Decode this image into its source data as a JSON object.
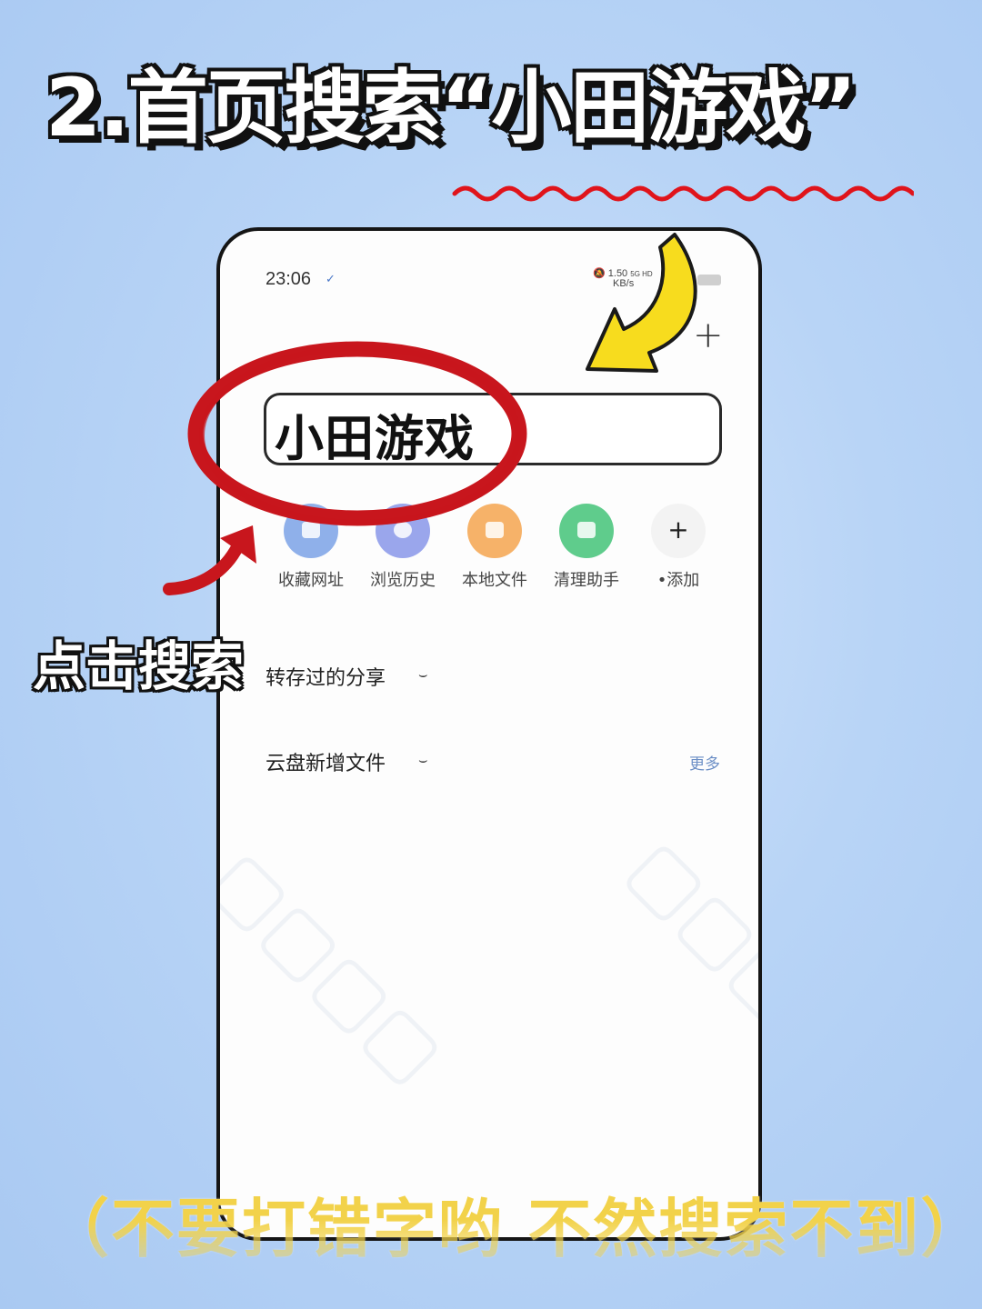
{
  "headline": "2.首页搜索“小田游戏”",
  "status_bar": {
    "time": "23:06",
    "net_speed": "1.50",
    "net_unit": "KB/s",
    "net_type": "5G HD"
  },
  "search": {
    "query": "小田游戏"
  },
  "quick_actions": [
    {
      "label": "收藏网址",
      "icon": "bookmark-icon"
    },
    {
      "label": "浏览历史",
      "icon": "history-icon"
    },
    {
      "label": "本地文件",
      "icon": "folder-icon"
    },
    {
      "label": "清理助手",
      "icon": "clean-icon"
    },
    {
      "label": "•添加",
      "icon": "plus-icon"
    }
  ],
  "sections": {
    "saved_shares": "转存过的分享",
    "cloud_new_files": "云盘新增文件",
    "more": "更多"
  },
  "annotations": {
    "tap_search": "点击搜索",
    "bottom_note": "（不要打错字哟  不然搜索不到）"
  },
  "colors": {
    "background": "#b8d4f6",
    "highlight_circle": "#c8161d",
    "arrow_yellow": "#f7dc1e",
    "wavy_underline": "#e0141b",
    "note_text": "#f2d24a"
  }
}
